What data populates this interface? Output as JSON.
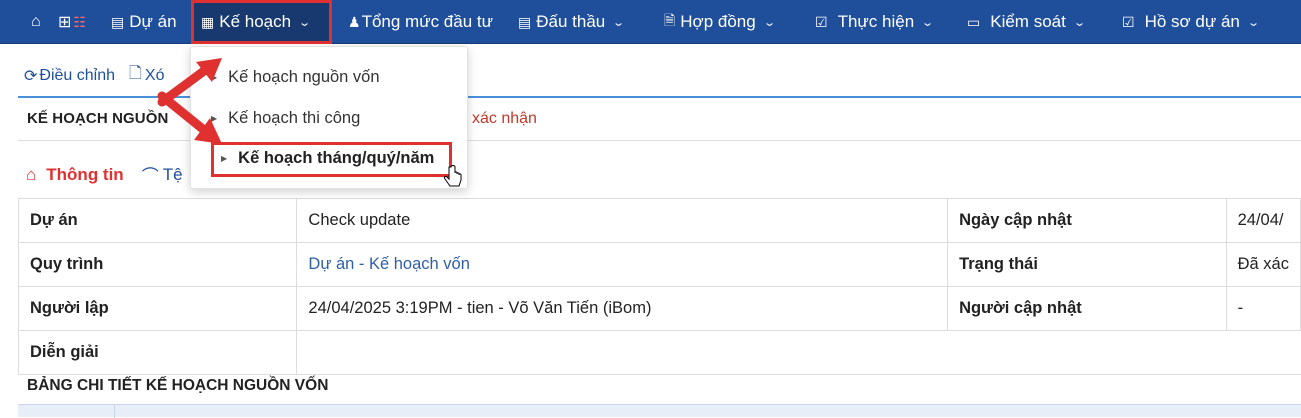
{
  "nav": {
    "home_icon": "home-icon",
    "items": [
      {
        "label": "",
        "icon": "grid-icon"
      },
      {
        "label": "Dự án",
        "icon": "project-icon"
      },
      {
        "label": "Kế hoạch",
        "icon": "plan-icon"
      },
      {
        "label": "Tổng mức đầu tư",
        "icon": "money-bag-icon"
      },
      {
        "label": "Đấu thầu",
        "icon": "bid-icon"
      },
      {
        "label": "Hợp đồng",
        "icon": "contract-icon"
      },
      {
        "label": "Thực hiện",
        "icon": "check-icon"
      },
      {
        "label": "Kiểm soát",
        "icon": "monitor-icon"
      },
      {
        "label": "Hồ sơ dự án",
        "icon": "folder-check-icon"
      }
    ]
  },
  "toolbar": {
    "adjust_label": "Điều chỉnh",
    "delete_label": "Xó"
  },
  "page": {
    "title": "KẾ HOẠCH NGUỒN",
    "status": "xác nhận"
  },
  "tabs": {
    "info": "Thông tin",
    "files": "Tệ"
  },
  "info": {
    "project_label": "Dự án",
    "project_value": "Check update",
    "updated_label": "Ngày cập nhật",
    "updated_value": "24/04/",
    "process_label": "Quy trình",
    "process_value": "Dự án - Kế hoạch vốn",
    "state_label": "Trạng thái",
    "state_value": "Đã xác",
    "creator_label": "Người lập",
    "creator_value": "24/04/2025 3:19PM - tien - Võ Văn Tiến (iBom)",
    "updater_label": "Người cập nhật",
    "updater_value": "-",
    "desc_label": "Diễn giải",
    "desc_value": ""
  },
  "section": {
    "title": "BẢNG CHI TIẾT KẾ HOẠCH NGUỒN VỐN"
  },
  "dropdown": {
    "items": [
      "Kế hoạch nguồn vốn",
      "Kế hoạch thi công",
      "Kế hoạch tháng/quý/năm"
    ]
  },
  "colors": {
    "nav_bg": "#1f4f9b",
    "highlight": "#e03131",
    "link": "#2f5fa7"
  }
}
